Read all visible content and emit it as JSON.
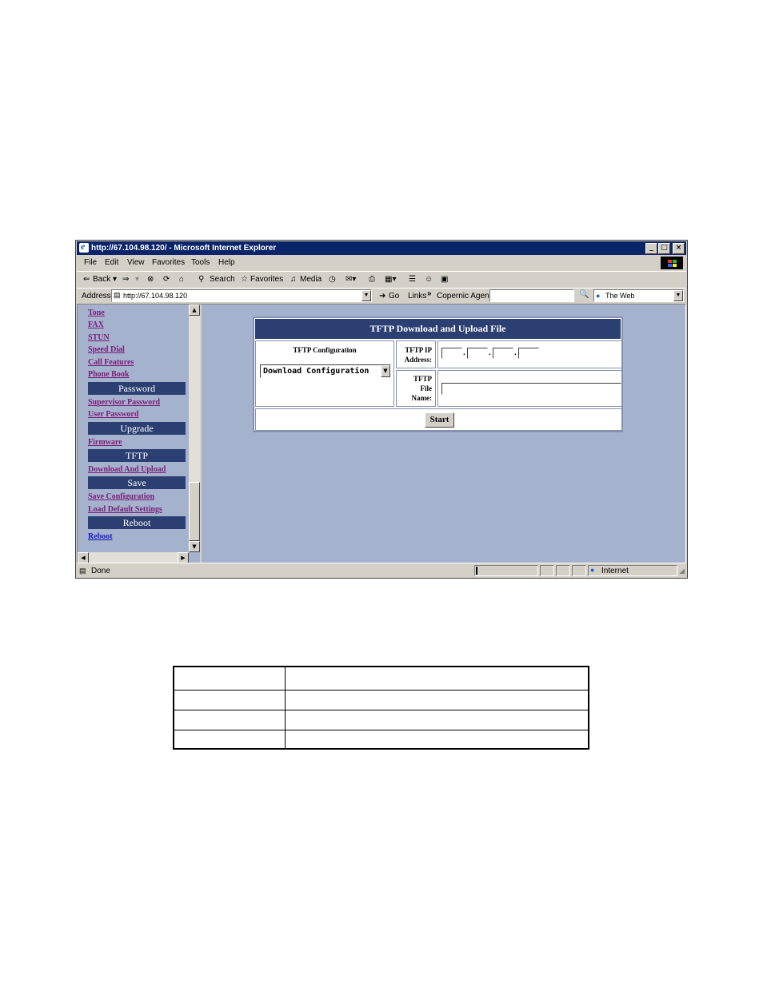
{
  "window": {
    "title": "http://67.104.98.120/ - Microsoft Internet Explorer",
    "controls": {
      "minimize": "_",
      "maximize": "□",
      "close": "×"
    }
  },
  "menu": [
    "File",
    "Edit",
    "View",
    "Favorites",
    "Tools",
    "Help"
  ],
  "toolbar": {
    "back": "Back",
    "search": "Search",
    "favorites": "Favorites",
    "media": "Media"
  },
  "address_bar": {
    "label": "Address",
    "url": "http://67.104.98.120",
    "go": "Go",
    "links": "Links",
    "agent_label": "Copernic Agent",
    "search_scope": "The Web"
  },
  "sidebar": {
    "links_top": [
      "Tone",
      "FAX",
      "STUN",
      "Speed Dial",
      "Call Features",
      "Phone Book"
    ],
    "password_header": "Password",
    "password_links": [
      "Supervisor Password",
      "User Password"
    ],
    "upgrade_header": "Upgrade",
    "upgrade_links": [
      "Firmware"
    ],
    "tftp_header": "TFTP",
    "tftp_links": [
      "Download And Upload"
    ],
    "save_header": "Save",
    "save_links": [
      "Save Configuration",
      "Load Default Settings"
    ],
    "reboot_header": "Reboot",
    "reboot_links": [
      "Reboot"
    ]
  },
  "tftp_panel": {
    "title": "TFTP Download and Upload File",
    "config_label": "TFTP Configuration",
    "config_selected": "Download Configuration",
    "ip_label_line1": "TFTP IP",
    "ip_label_line2": "Address:",
    "ip_octets": [
      "",
      "",
      "",
      ""
    ],
    "file_label_line1": "TFTP",
    "file_label_line2": "File",
    "file_label_line3": "Name:",
    "file_value": "",
    "start_button": "Start"
  },
  "status_bar": {
    "status": "Done",
    "zone": "Internet"
  }
}
